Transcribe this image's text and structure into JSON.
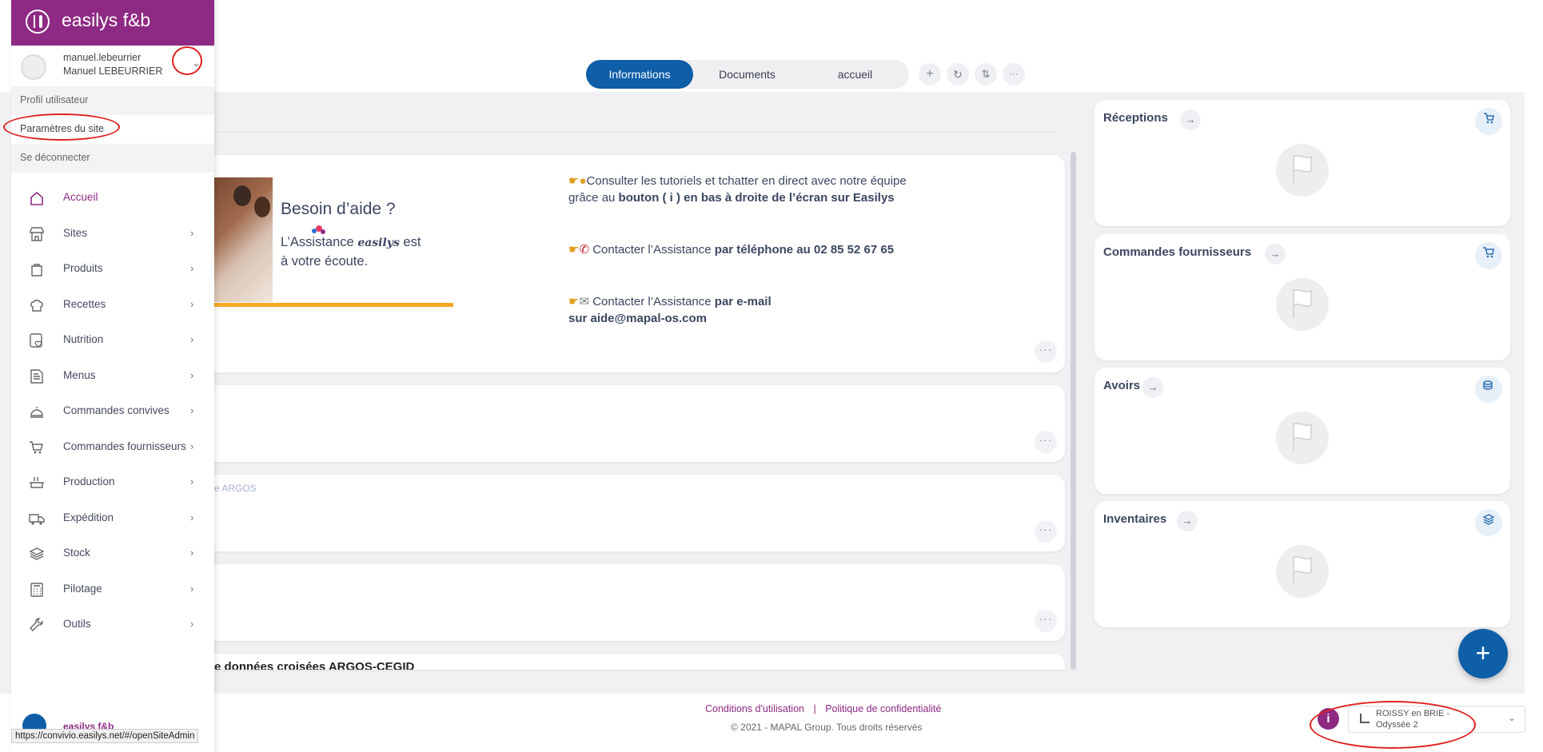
{
  "tabs": {
    "items": [
      "Informations",
      "Documents",
      "accueil"
    ],
    "active": "Informations"
  },
  "toolbar": {
    "add": "+",
    "refresh": "↻",
    "sort": "⇅",
    "more": "···"
  },
  "help_card": {
    "title": "Besoin d’aide ?",
    "assist_prefix": "L’Assistance",
    "assist_brand": "easilys",
    "assist_suffix": "est",
    "assist_line2": "à votre écoute.",
    "line1_a": "Consulter les tutoriels et tchatter en direct avec notre équipe",
    "line1_b": "grâce au",
    "line1_bold": "bouton ( i ) en bas à droite de l’écran sur Easilys",
    "line2_a": "Contacter l’Assistance",
    "line2_bold": "par téléphone au 02 85 52 67 65",
    "line3_a": "Contacter l’Assistance",
    "line3_bold": "par e-mail",
    "line3_b": "sur aide@mapal-os.com"
  },
  "card3_text": "e ARGOS",
  "card5_text": "e données croisées ARGOS-CEGID",
  "widgets": [
    {
      "title": "Réceptions",
      "icon": "reception-icon"
    },
    {
      "title": "Commandes fournisseurs",
      "icon": "cart-icon"
    },
    {
      "title": "Avoirs",
      "icon": "coins-icon"
    },
    {
      "title": "Inventaires",
      "icon": "box-icon"
    }
  ],
  "fab": "+",
  "footer": {
    "terms": "Conditions d'utilisation",
    "sep": "|",
    "privacy": "Politique de confidentialité",
    "copyright": "© 2021 - MAPAL Group. Tous droits réservés"
  },
  "site_selector": {
    "line1": "ROISSY en BRIE -",
    "line2": "Odyssée 2"
  },
  "sidebar": {
    "brand": "easilys f&b",
    "user_login": "manuel.lebeurrier",
    "user_name": "Manuel LEBEURRIER",
    "user_menu": [
      "Profil utilisateur",
      "Paramètres du site",
      "Se déconnecter"
    ],
    "items": [
      {
        "label": "Accueil",
        "icon": "home-icon",
        "chevron": false,
        "active": true
      },
      {
        "label": "Sites",
        "icon": "store-icon",
        "chevron": true
      },
      {
        "label": "Produits",
        "icon": "bag-icon",
        "chevron": true
      },
      {
        "label": "Recettes",
        "icon": "chef-hat-icon",
        "chevron": true
      },
      {
        "label": "Nutrition",
        "icon": "nutrition-icon",
        "chevron": true
      },
      {
        "label": "Menus",
        "icon": "menu-doc-icon",
        "chevron": true
      },
      {
        "label": "Commandes convives",
        "icon": "cloche-icon",
        "chevron": true
      },
      {
        "label": "Commandes fournisseurs",
        "icon": "cart-icon",
        "chevron": true
      },
      {
        "label": "Production",
        "icon": "pot-icon",
        "chevron": true
      },
      {
        "label": "Expédition",
        "icon": "truck-icon",
        "chevron": true
      },
      {
        "label": "Stock",
        "icon": "stack-icon",
        "chevron": true
      },
      {
        "label": "Pilotage",
        "icon": "calculator-icon",
        "chevron": true
      },
      {
        "label": "Outils",
        "icon": "wrench-icon",
        "chevron": true
      }
    ],
    "bottom_brand": "easilys f&b"
  },
  "status_url": "https://convivio.easilys.net/#/openSiteAdmin",
  "colors": {
    "brand": "#8e2a83",
    "primary": "#0e5ea8",
    "annotation": "#e02020",
    "highlight": "#f5a623"
  }
}
